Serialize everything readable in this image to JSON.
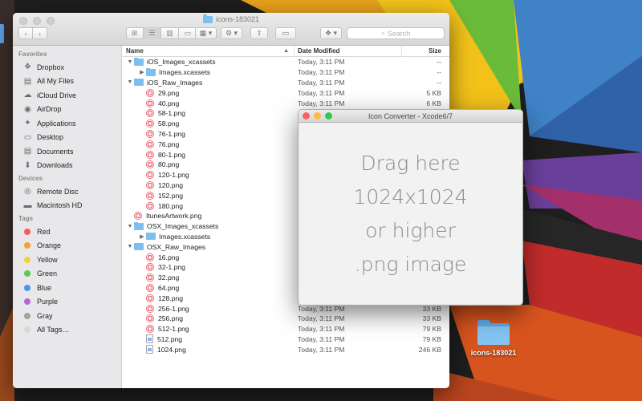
{
  "desktop": {
    "folder_label": "icons-183021"
  },
  "finder": {
    "title": "icons-183021",
    "search_placeholder": "Search",
    "sidebar": {
      "sections": [
        {
          "title": "Favorites",
          "items": [
            {
              "label": "Dropbox",
              "icon": "dropbox-icon"
            },
            {
              "label": "All My Files",
              "icon": "all-files-icon"
            },
            {
              "label": "iCloud Drive",
              "icon": "cloud-icon"
            },
            {
              "label": "AirDrop",
              "icon": "airdrop-icon"
            },
            {
              "label": "Applications",
              "icon": "applications-icon"
            },
            {
              "label": "Desktop",
              "icon": "desktop-icon"
            },
            {
              "label": "Documents",
              "icon": "documents-icon"
            },
            {
              "label": "Downloads",
              "icon": "downloads-icon"
            }
          ]
        },
        {
          "title": "Devices",
          "items": [
            {
              "label": "Remote Disc",
              "icon": "disc-icon"
            },
            {
              "label": "Macintosh HD",
              "icon": "hard-drive-icon"
            }
          ]
        },
        {
          "title": "Tags",
          "items": [
            {
              "label": "Red",
              "color": "#f25c5c"
            },
            {
              "label": "Orange",
              "color": "#f5a030"
            },
            {
              "label": "Yellow",
              "color": "#f2d13a"
            },
            {
              "label": "Green",
              "color": "#5cc65a"
            },
            {
              "label": "Blue",
              "color": "#4a95ee"
            },
            {
              "label": "Purple",
              "color": "#b468d6"
            },
            {
              "label": "Gray",
              "color": "#a2a2a2"
            },
            {
              "label": "All Tags…",
              "color": "#d8d8d8"
            }
          ]
        }
      ]
    },
    "columns": {
      "name": "Name",
      "date": "Date Modified",
      "size": "Size"
    },
    "rows": [
      {
        "depth": 0,
        "kind": "folder",
        "expand": "open",
        "name": "iOS_Images_xcassets",
        "date": "Today, 3:11 PM",
        "size": "--"
      },
      {
        "depth": 1,
        "kind": "folder",
        "expand": "closed",
        "name": "Images.xcassets",
        "date": "Today, 3:11 PM",
        "size": "--"
      },
      {
        "depth": 0,
        "kind": "folder",
        "expand": "open",
        "name": "iOS_Raw_Images",
        "date": "Today, 3:11 PM",
        "size": "--"
      },
      {
        "depth": 1,
        "kind": "png",
        "name": "29.png",
        "date": "Today, 3:11 PM",
        "size": "5 KB"
      },
      {
        "depth": 1,
        "kind": "png",
        "name": "40.png",
        "date": "Today, 3:11 PM",
        "size": "6 KB"
      },
      {
        "depth": 1,
        "kind": "png",
        "name": "58-1.png",
        "date": "",
        "size": ""
      },
      {
        "depth": 1,
        "kind": "png",
        "name": "58.png",
        "date": "",
        "size": ""
      },
      {
        "depth": 1,
        "kind": "png",
        "name": "76-1.png",
        "date": "",
        "size": ""
      },
      {
        "depth": 1,
        "kind": "png",
        "name": "76.png",
        "date": "",
        "size": ""
      },
      {
        "depth": 1,
        "kind": "png",
        "name": "80-1.png",
        "date": "",
        "size": ""
      },
      {
        "depth": 1,
        "kind": "png",
        "name": "80.png",
        "date": "",
        "size": ""
      },
      {
        "depth": 1,
        "kind": "png",
        "name": "120-1.png",
        "date": "",
        "size": ""
      },
      {
        "depth": 1,
        "kind": "png",
        "name": "120.png",
        "date": "",
        "size": ""
      },
      {
        "depth": 1,
        "kind": "png",
        "name": "152.png",
        "date": "",
        "size": ""
      },
      {
        "depth": 1,
        "kind": "png",
        "name": "180.png",
        "date": "",
        "size": ""
      },
      {
        "depth": 0,
        "kind": "png",
        "name": "ItunesArtwork.png",
        "date": "",
        "size": ""
      },
      {
        "depth": 0,
        "kind": "folder",
        "expand": "open",
        "name": "OSX_Images_xcassets",
        "date": "",
        "size": ""
      },
      {
        "depth": 1,
        "kind": "folder",
        "expand": "closed",
        "name": "Images.xcassets",
        "date": "",
        "size": ""
      },
      {
        "depth": 0,
        "kind": "folder",
        "expand": "open",
        "name": "OSX_Raw_Images",
        "date": "",
        "size": ""
      },
      {
        "depth": 1,
        "kind": "png",
        "name": "16.png",
        "date": "",
        "size": ""
      },
      {
        "depth": 1,
        "kind": "png",
        "name": "32-1.png",
        "date": "",
        "size": ""
      },
      {
        "depth": 1,
        "kind": "png",
        "name": "32.png",
        "date": "",
        "size": ""
      },
      {
        "depth": 1,
        "kind": "png",
        "name": "64.png",
        "date": "",
        "size": ""
      },
      {
        "depth": 1,
        "kind": "png",
        "name": "128.png",
        "date": "",
        "size": ""
      },
      {
        "depth": 1,
        "kind": "png",
        "name": "256-1.png",
        "date": "Today, 3:11 PM",
        "size": "33 KB"
      },
      {
        "depth": 1,
        "kind": "png",
        "name": "256.png",
        "date": "Today, 3:11 PM",
        "size": "33 KB"
      },
      {
        "depth": 1,
        "kind": "png",
        "name": "512-1.png",
        "date": "Today, 3:11 PM",
        "size": "79 KB"
      },
      {
        "depth": 1,
        "kind": "doc",
        "name": "512.png",
        "date": "Today, 3:11 PM",
        "size": "79 KB"
      },
      {
        "depth": 1,
        "kind": "doc",
        "name": "1024.png",
        "date": "Today, 3:11 PM",
        "size": "246 KB"
      }
    ]
  },
  "converter": {
    "title": "Icon Converter - Xcode6/7",
    "drop_lines": [
      "Drag here",
      "1024x1024",
      "or higher",
      ".png image"
    ]
  }
}
